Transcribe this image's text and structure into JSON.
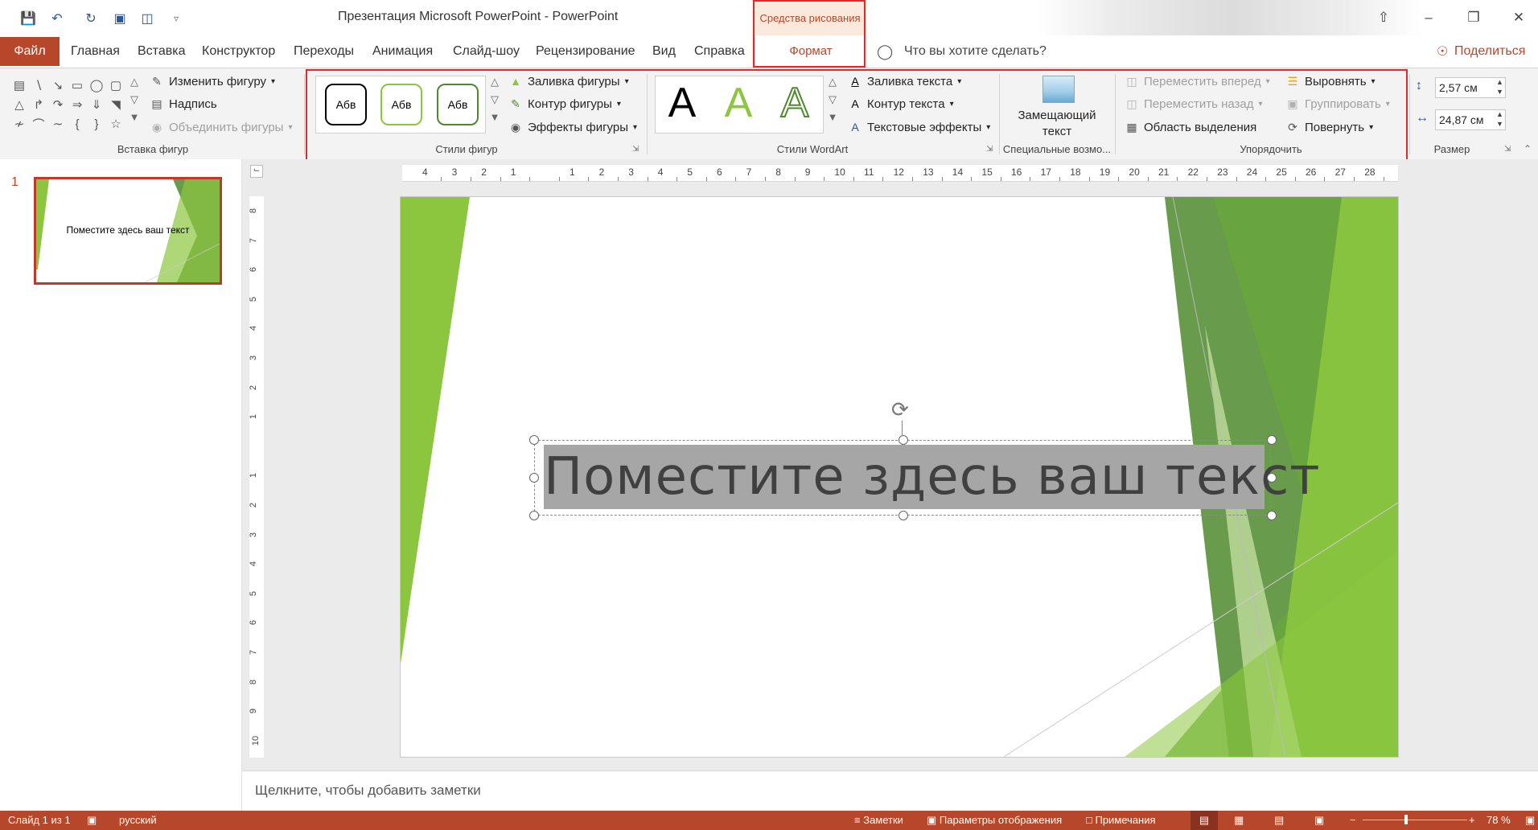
{
  "window": {
    "title": "Презентация Microsoft PowerPoint  -  PowerPoint",
    "context_tab_header": "Средства рисования"
  },
  "tabs": {
    "file": "Файл",
    "items": [
      "Главная",
      "Вставка",
      "Конструктор",
      "Переходы",
      "Анимация",
      "Слайд-шоу",
      "Рецензирование",
      "Вид",
      "Справка"
    ],
    "format": "Формат",
    "tell_me": "Что вы хотите сделать?",
    "share": "Поделиться"
  },
  "ribbon": {
    "insert_shapes": {
      "edit_shape": "Изменить фигуру",
      "text_box": "Надпись",
      "merge_shapes": "Объединить фигуры",
      "group_label": "Вставка фигур"
    },
    "shape_styles": {
      "chip_text": "Абв",
      "fill": "Заливка фигуры",
      "outline": "Контур фигуры",
      "effects": "Эффекты фигуры",
      "group_label": "Стили фигур"
    },
    "wordart": {
      "letter": "A",
      "text_fill": "Заливка текста",
      "text_outline": "Контур текста",
      "text_effects": "Текстовые эффекты",
      "group_label": "Стили WordArt"
    },
    "accessibility": {
      "alt_text_line1": "Замещающий",
      "alt_text_line2": "текст",
      "group_label": "Специальные возмо..."
    },
    "arrange": {
      "bring_forward": "Переместить вперед",
      "send_backward": "Переместить назад",
      "selection_pane": "Область выделения",
      "align": "Выровнять",
      "group": "Группировать",
      "rotate": "Повернуть",
      "group_label": "Упорядочить"
    },
    "size": {
      "height": "2,57 см",
      "width": "24,87 см",
      "group_label": "Размер"
    }
  },
  "slides_pane": {
    "slide_number": "1",
    "thumb_text": "Поместите здесь ваш текст"
  },
  "ruler": {
    "h_ticks": [
      "4",
      "3",
      "2",
      "1",
      "",
      "1",
      "2",
      "3",
      "4",
      "5",
      "6",
      "7",
      "8",
      "9",
      "10",
      "11",
      "12",
      "13",
      "14",
      "15",
      "16",
      "17",
      "18",
      "19",
      "20",
      "21",
      "22",
      "23",
      "24",
      "25",
      "26",
      "27",
      "28"
    ],
    "v_ticks": [
      "8",
      "7",
      "6",
      "5",
      "4",
      "3",
      "2",
      "1",
      "",
      "1",
      "2",
      "3",
      "4",
      "5",
      "6",
      "7",
      "8",
      "9",
      "10"
    ]
  },
  "slide": {
    "title_text": "Поместите здесь ваш текст"
  },
  "notes": {
    "placeholder": "Щелкните, чтобы добавить заметки"
  },
  "status": {
    "slide_info": "Слайд 1 из 1",
    "language": "русский",
    "notes": "Заметки",
    "display_settings": "Параметры отображения",
    "comments": "Примечания",
    "zoom": "78 %",
    "zoom_level": 0.78
  },
  "colors": {
    "accent": "#b7472a",
    "highlight_box": "#e02b2b",
    "green_dark": "#4e8a2b",
    "green_light": "#8cc63f"
  }
}
